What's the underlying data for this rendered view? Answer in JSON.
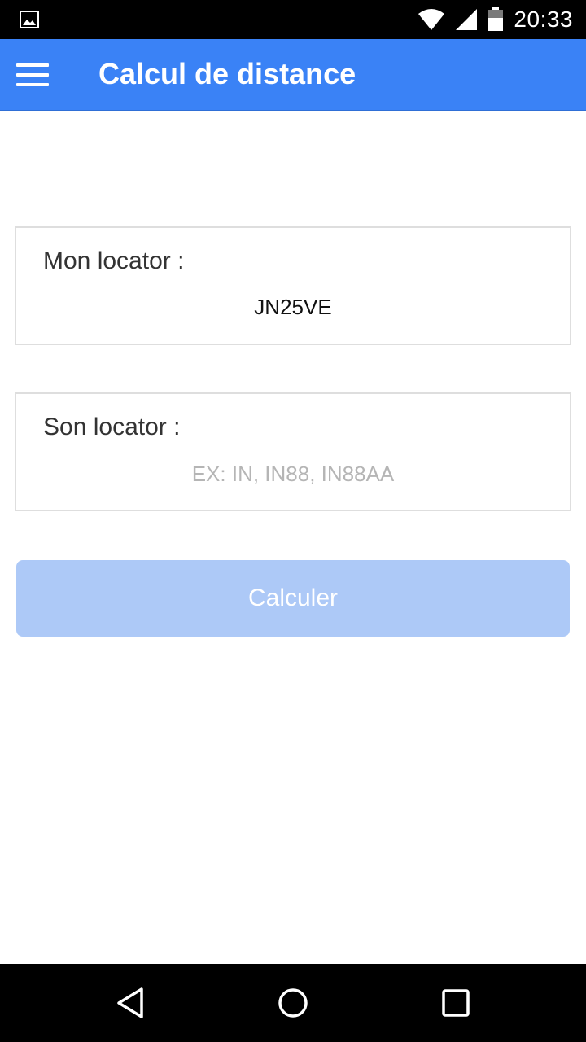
{
  "status_bar": {
    "time": "20:33",
    "icons": [
      "image-notification-icon",
      "wifi-icon",
      "cell-signal-icon",
      "battery-icon"
    ]
  },
  "app_bar": {
    "title": "Calcul de distance",
    "menu_icon": "hamburger-menu-icon",
    "background_color": "#3a82f6"
  },
  "my_locator": {
    "label": "Mon locator :",
    "value": "JN25VE"
  },
  "their_locator": {
    "label": "Son locator :",
    "value": "",
    "placeholder": "EX: IN, IN88, IN88AA"
  },
  "calculate_button": {
    "label": "Calculer",
    "color": "#adc9f7",
    "disabled": true
  },
  "nav_bar": {
    "icons": [
      "back-icon",
      "home-icon",
      "recents-icon"
    ]
  }
}
